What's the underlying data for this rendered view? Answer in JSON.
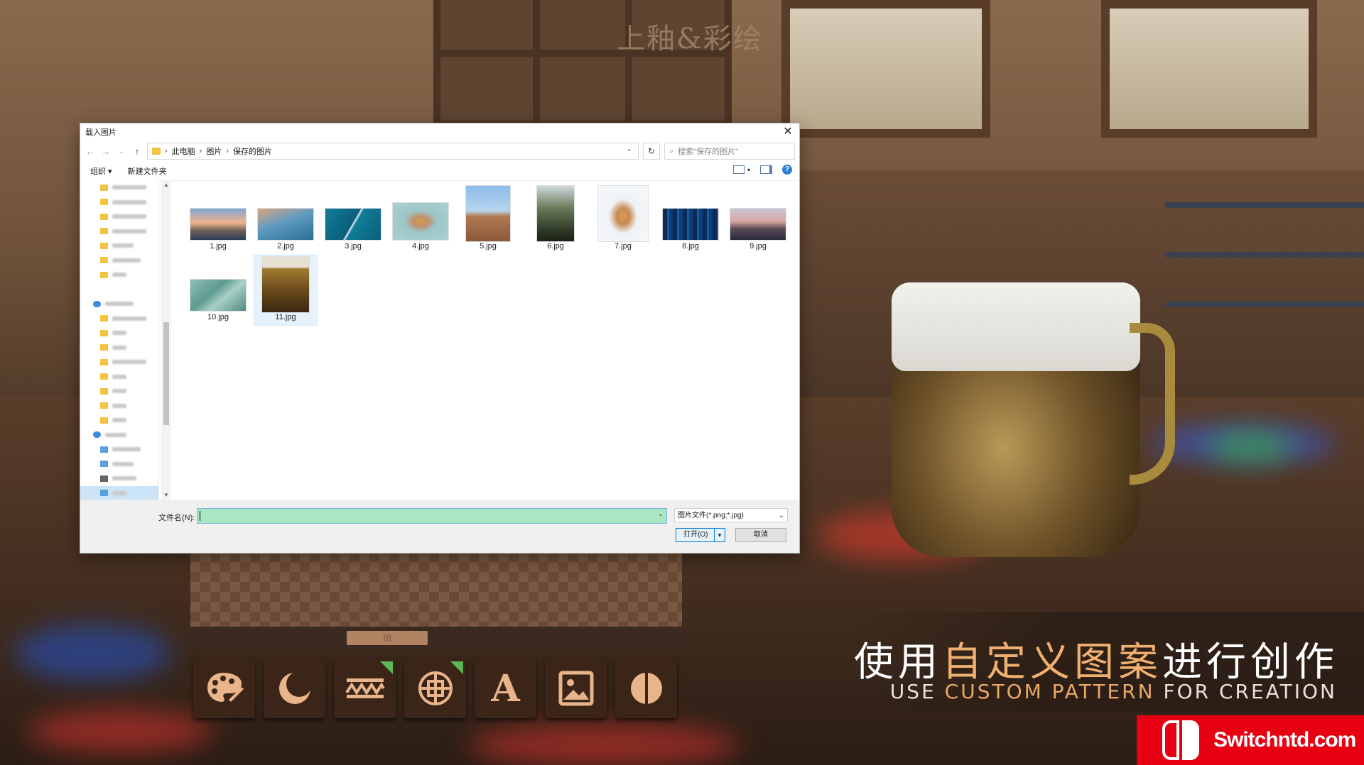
{
  "game": {
    "title": "上釉&彩绘",
    "tools": [
      {
        "icon": "palette-icon"
      },
      {
        "icon": "crescent-circle-icon"
      },
      {
        "icon": "zigzag-band-icon",
        "badge": true
      },
      {
        "icon": "circle-pattern-icon",
        "badge": true
      },
      {
        "icon": "text-tool-icon",
        "label": "A"
      },
      {
        "icon": "image-icon"
      },
      {
        "icon": "half-circle-icon"
      }
    ]
  },
  "promo": {
    "cn_before": "使用",
    "cn_highlight": "自定义图案",
    "cn_after": "进行创作",
    "en_before": "USE ",
    "en_highlight": "CUSTOM PATTERN",
    "en_after": " FOR CREATION"
  },
  "watermark": {
    "text": "Switchntd.com"
  },
  "dialog": {
    "title": "载入图片",
    "breadcrumb": [
      "此电脑",
      "图片",
      "保存的图片"
    ],
    "search_placeholder": "搜索\"保存的图片\"",
    "toolbar": {
      "organize": "组织 ▾",
      "new_folder": "新建文件夹"
    },
    "files": [
      {
        "name": "1.jpg",
        "selected": false
      },
      {
        "name": "2.jpg",
        "selected": false
      },
      {
        "name": "3.jpg",
        "selected": false
      },
      {
        "name": "4.jpg",
        "selected": false
      },
      {
        "name": "5.jpg",
        "selected": false
      },
      {
        "name": "6.jpg",
        "selected": false
      },
      {
        "name": "7.jpg",
        "selected": false
      },
      {
        "name": "8.jpg",
        "selected": false
      },
      {
        "name": "9.jpg",
        "selected": false
      },
      {
        "name": "10.jpg",
        "selected": false
      },
      {
        "name": "11.jpg",
        "selected": true
      }
    ],
    "filename_label": "文件名(N):",
    "filename_value": "",
    "filetype": "图片文件(*.png;*.jpg)",
    "open_button": "打开(O)",
    "cancel_button": "取消"
  },
  "colors": {
    "accent": "#f0b070",
    "selection": "#cce4f7",
    "filename_field": "#a8e6c4",
    "watermark": "#e60012"
  }
}
